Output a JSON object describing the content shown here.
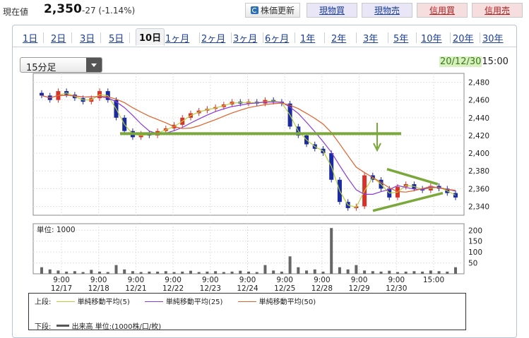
{
  "header": {
    "price_label": "現在値",
    "price_value": "2,350",
    "price_change": "-27 (-1.14%)",
    "refresh_label": "株価更新",
    "buttons": [
      "現物買",
      "現物売",
      "信用買",
      "信用売"
    ]
  },
  "tabs": [
    "1日",
    "2日",
    "3日",
    "5日",
    "10日",
    "1ヶ月",
    "2ヶ月",
    "3ヶ月",
    "6ヶ月",
    "1年",
    "2年",
    "3年",
    "5年",
    "10年",
    "20年",
    "30年"
  ],
  "active_tab": "10日",
  "interval_select": "15分足",
  "datestamp": {
    "date": "20/12/30",
    "time": "15:00"
  },
  "volume_unit_label": "単位: 1000",
  "legend": {
    "upper_label": "上段:",
    "lower_label": "下段:",
    "ma5": "単純移動平均(5)",
    "ma25": "単純移動平均(25)",
    "ma50": "単純移動平均(50)",
    "volume": "出来高 単位:(1000株/口/枚)"
  },
  "colors": {
    "ma5": "#b7cf3a",
    "ma25": "#8a3ad6",
    "ma50": "#e0602a",
    "trendline": "#7aa83a",
    "up_candle": "#d8322a",
    "down_candle": "#1a2aa0",
    "volume": "#666666"
  },
  "chart_data": {
    "type": "candlestick",
    "price_axis": {
      "ticks": [
        "2,480",
        "2,460",
        "2,440",
        "2,420",
        "2,400",
        "2,380",
        "2,360",
        "2,340"
      ],
      "range": [
        2330,
        2490
      ]
    },
    "volume_axis": {
      "ticks": [
        "200",
        "150",
        "100",
        "50"
      ],
      "range": [
        0,
        230
      ]
    },
    "x_labels": [
      {
        "time": "9:00",
        "date": "12/17"
      },
      {
        "time": "9:00",
        "date": "12/18"
      },
      {
        "time": "9:00",
        "date": "12/21"
      },
      {
        "time": "9:00",
        "date": "12/22"
      },
      {
        "time": "9:00",
        "date": "12/23"
      },
      {
        "time": "9:00",
        "date": "12/24"
      },
      {
        "time": "9:00",
        "date": "12/25"
      },
      {
        "time": "9:00",
        "date": "12/28"
      },
      {
        "time": "9:00",
        "date": "12/29"
      },
      {
        "time": "9:00",
        "date": "12/30"
      },
      {
        "time": "15:00",
        "date": ""
      }
    ],
    "close_path": [
      2465,
      2460,
      2470,
      2466,
      2462,
      2458,
      2462,
      2470,
      2460,
      2440,
      2425,
      2418,
      2422,
      2420,
      2425,
      2428,
      2432,
      2440,
      2445,
      2448,
      2450,
      2452,
      2455,
      2458,
      2456,
      2458,
      2456,
      2460,
      2458,
      2456,
      2430,
      2420,
      2410,
      2405,
      2400,
      2370,
      2345,
      2338,
      2340,
      2375,
      2370,
      2360,
      2350,
      2362,
      2365,
      2360,
      2358,
      2363,
      2360,
      2355,
      2350
    ],
    "volume": [
      30,
      20,
      15,
      10,
      12,
      8,
      18,
      10,
      8,
      40,
      20,
      12,
      8,
      10,
      10,
      12,
      8,
      10,
      14,
      8,
      10,
      12,
      8,
      10,
      14,
      10,
      8,
      40,
      15,
      10,
      80,
      30,
      15,
      20,
      10,
      210,
      30,
      20,
      40,
      15,
      12,
      10,
      14,
      8,
      10,
      12,
      10,
      15,
      12,
      10,
      30
    ],
    "annotations": [
      {
        "type": "horizontal_line",
        "price": 2422
      },
      {
        "type": "triangle_upper",
        "from": 2382,
        "to": 2365
      },
      {
        "type": "triangle_lower",
        "from": 2335,
        "to": 2355
      },
      {
        "type": "down_arrow"
      }
    ]
  }
}
